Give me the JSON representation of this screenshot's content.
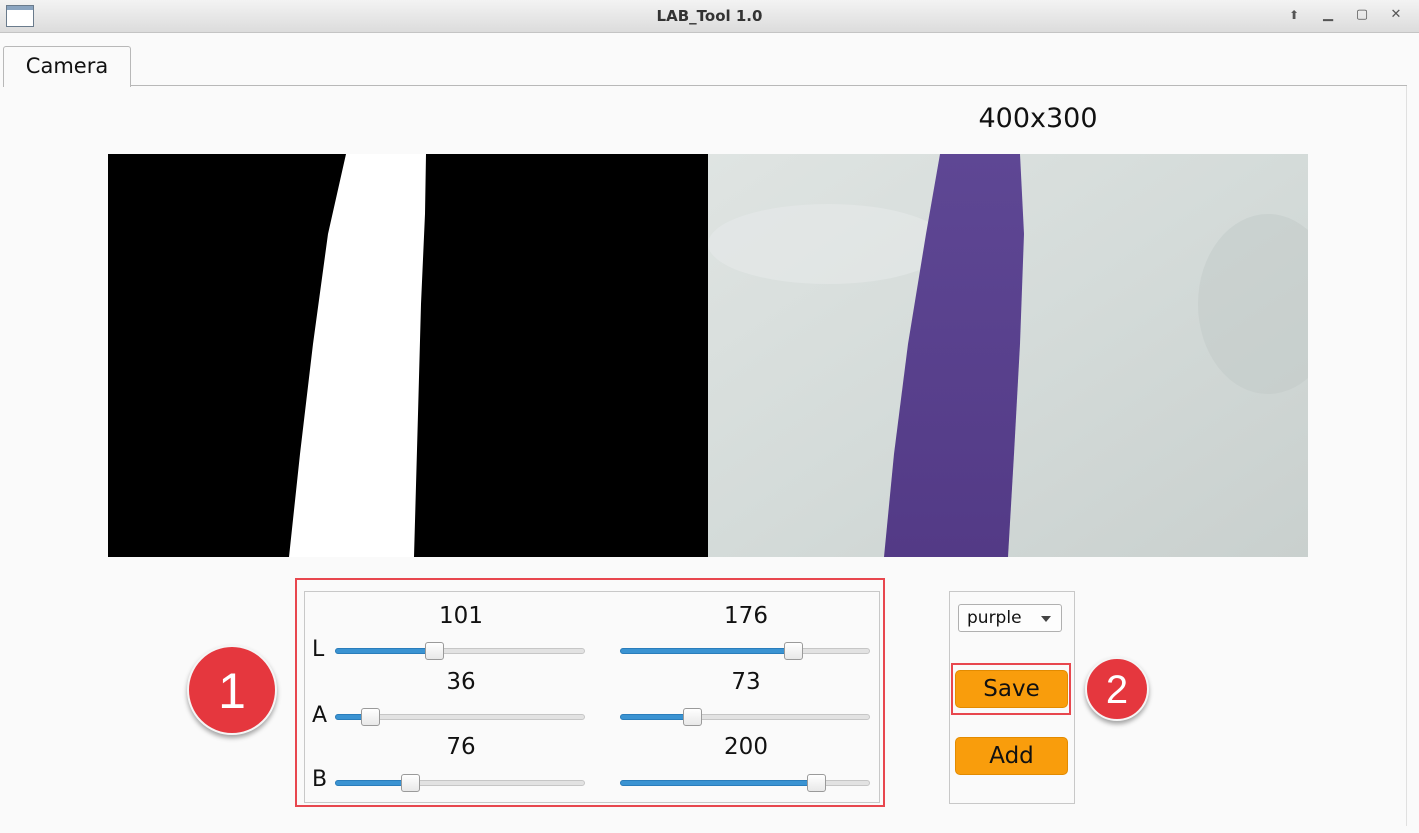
{
  "window": {
    "title": "LAB_Tool 1.0",
    "controls": [
      "pin-icon",
      "minimize-icon",
      "maximize-icon",
      "close-icon"
    ]
  },
  "tabs": [
    {
      "label": "Camera",
      "active": true
    }
  ],
  "view": {
    "resolution_label": "400x300"
  },
  "sliders": {
    "range_max": 255,
    "rows": [
      {
        "axis": "L",
        "min_value": "101",
        "max_value": "176",
        "min_fraction": 0.396,
        "max_fraction": 0.69
      },
      {
        "axis": "A",
        "min_value": "36",
        "max_value": "73",
        "min_fraction": 0.141,
        "max_fraction": 0.286
      },
      {
        "axis": "B",
        "min_value": "76",
        "max_value": "200",
        "min_fraction": 0.298,
        "max_fraction": 0.784
      }
    ]
  },
  "controls": {
    "color_select": {
      "selected": "purple"
    },
    "save_label": "Save",
    "add_label": "Add"
  },
  "annotations": {
    "callout_1": "1",
    "callout_2": "2"
  },
  "colors": {
    "accent_orange": "#f99d0c",
    "slider_fill": "#3a93d2",
    "highlight_red": "#e8474e",
    "ribbon_purple": "#5a3f8f"
  }
}
